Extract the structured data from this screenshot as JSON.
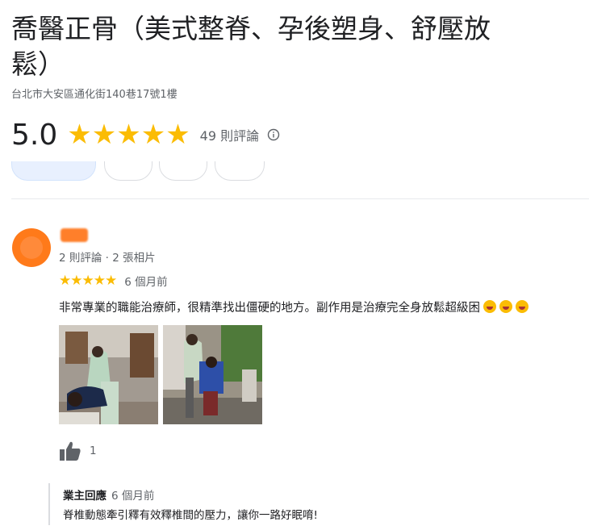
{
  "place": {
    "title": "喬醫正骨（美式整脊、孕後塑身、舒壓放鬆）",
    "address": "台北市大安區通化街140巷17號1樓",
    "rating": "5.0",
    "stars": "★★★★★",
    "review_count": "49 則評論"
  },
  "review": {
    "reviewer_meta": "2 則評論 · 2 張相片",
    "stars": "★★★★★",
    "rating_value": 5,
    "time_ago": "6 個月前",
    "text": "非常專業的職能治療師，很精準找出僵硬的地方。副作用是治療完全身放鬆超級困",
    "emoji_icon": "grinning-squinting-face-icon",
    "likes": "1"
  },
  "owner_response": {
    "label": "業主回應",
    "time_ago": "6 個月前",
    "text": "脊椎動態牽引釋有效釋椎間的壓力，讓你一路好眠唷!"
  },
  "colors": {
    "star": "#fbbc04",
    "avatar": "#ff7a1a",
    "secondary_text": "#5f6368",
    "primary_text": "#202124"
  }
}
